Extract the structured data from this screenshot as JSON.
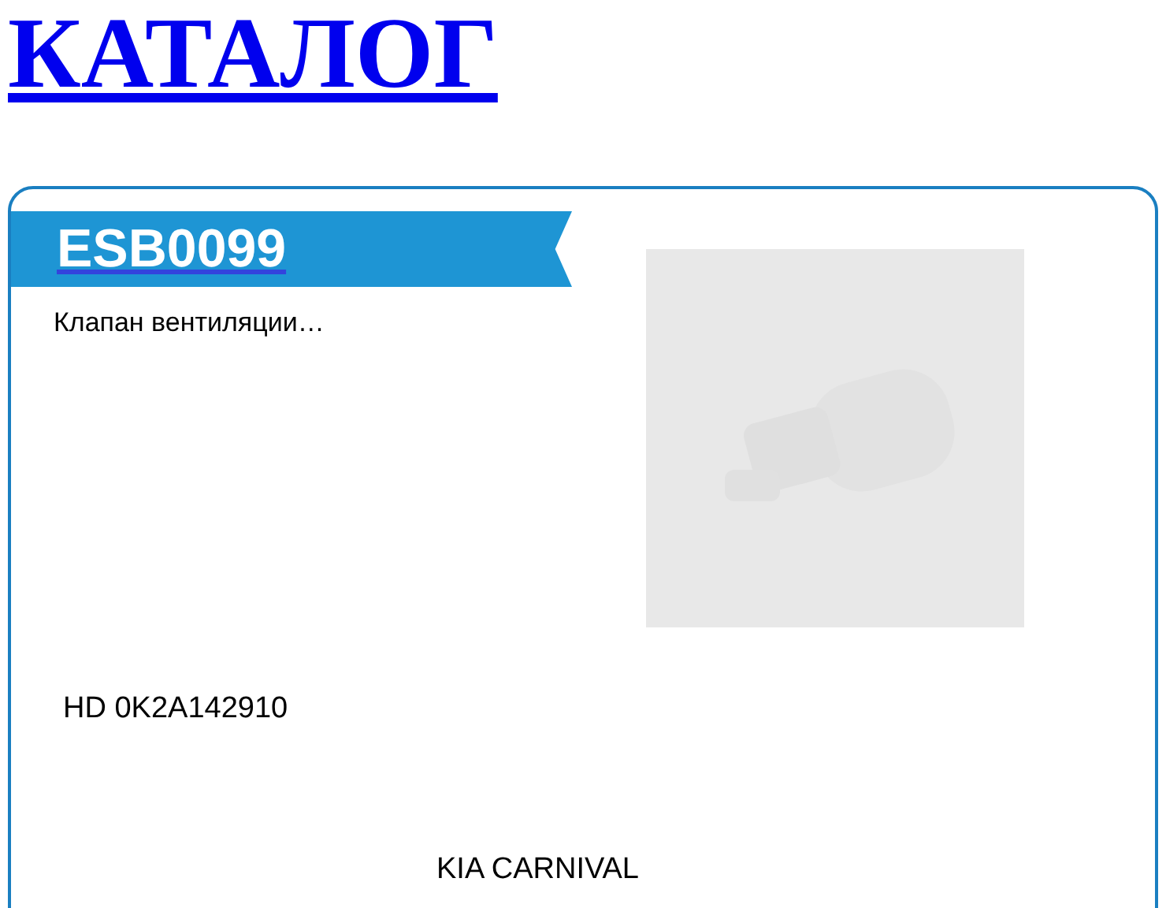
{
  "page_title": "КАТАЛОГ",
  "product": {
    "code": "ESB0099",
    "description": "Клапан вентиляции…",
    "part_number": "HD 0K2A142910",
    "model": "KIA CARNIVAL"
  }
}
